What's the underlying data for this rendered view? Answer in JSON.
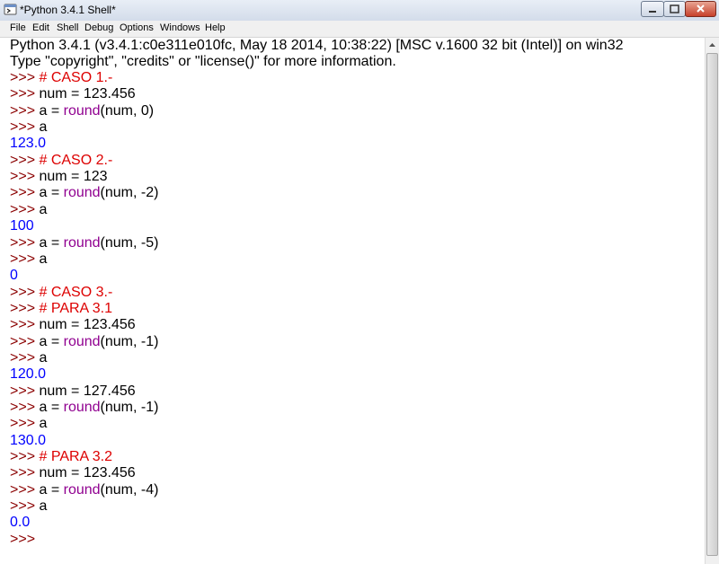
{
  "window": {
    "title": "*Python 3.4.1 Shell*"
  },
  "menu": [
    "File",
    "Edit",
    "Shell",
    "Debug",
    "Options",
    "Windows",
    "Help"
  ],
  "shell": {
    "prompt": ">>> ",
    "header": [
      "Python 3.4.1 (v3.4.1:c0e311e010fc, May 18 2014, 10:38:22) [MSC v.1600 32 bit (Intel)] on win32",
      "Type \"copyright\", \"credits\" or \"license()\" for more information."
    ],
    "lines": [
      {
        "kind": "comment",
        "text": "# CASO 1.-"
      },
      {
        "kind": "code",
        "text": "num = 123.456"
      },
      {
        "kind": "call",
        "pre": "a = ",
        "fn": "round",
        "post": "(num, 0)"
      },
      {
        "kind": "code",
        "text": "a"
      },
      {
        "kind": "output",
        "text": "123.0"
      },
      {
        "kind": "comment",
        "text": "# CASO 2.-"
      },
      {
        "kind": "code",
        "text": "num = 123"
      },
      {
        "kind": "call",
        "pre": "a = ",
        "fn": "round",
        "post": "(num, -2)"
      },
      {
        "kind": "code",
        "text": "a"
      },
      {
        "kind": "output",
        "text": "100"
      },
      {
        "kind": "call",
        "pre": "a = ",
        "fn": "round",
        "post": "(num, -5)"
      },
      {
        "kind": "code",
        "text": "a"
      },
      {
        "kind": "output",
        "text": "0"
      },
      {
        "kind": "comment",
        "text": "# CASO 3.-"
      },
      {
        "kind": "comment",
        "text": "# PARA 3.1"
      },
      {
        "kind": "code",
        "text": "num = 123.456"
      },
      {
        "kind": "call",
        "pre": "a = ",
        "fn": "round",
        "post": "(num, -1)"
      },
      {
        "kind": "code",
        "text": "a"
      },
      {
        "kind": "output",
        "text": "120.0"
      },
      {
        "kind": "code",
        "text": "num = 127.456"
      },
      {
        "kind": "call",
        "pre": "a = ",
        "fn": "round",
        "post": "(num, -1)"
      },
      {
        "kind": "code",
        "text": "a"
      },
      {
        "kind": "output",
        "text": "130.0"
      },
      {
        "kind": "comment",
        "text": "# PARA 3.2"
      },
      {
        "kind": "code",
        "text": "num = 123.456"
      },
      {
        "kind": "call",
        "pre": "a = ",
        "fn": "round",
        "post": "(num, -4)"
      },
      {
        "kind": "code",
        "text": "a"
      },
      {
        "kind": "output",
        "text": "0.0"
      },
      {
        "kind": "prompt",
        "text": ""
      }
    ]
  },
  "colors": {
    "prompt": "#8b0000",
    "comment": "#dd0000",
    "builtin": "#900090",
    "output": "#0000ff"
  }
}
